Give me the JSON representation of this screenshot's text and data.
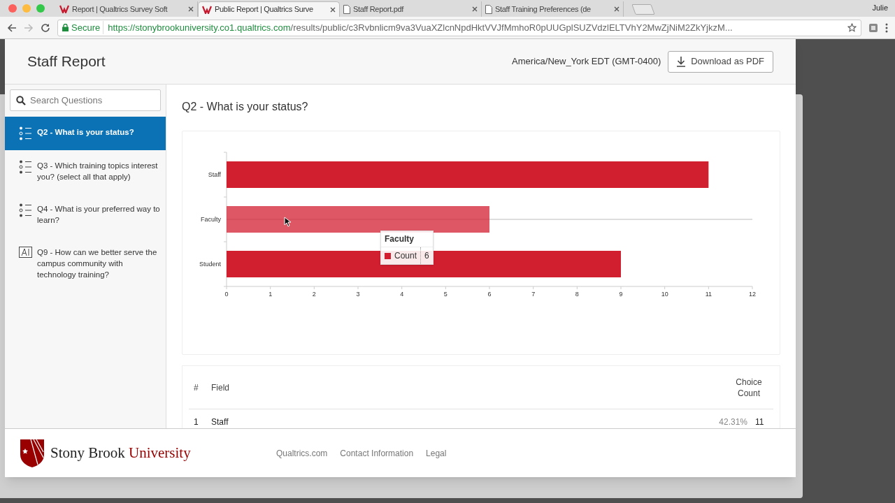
{
  "browser": {
    "tabs": [
      {
        "title": "Report | Qualtrics Survey Soft",
        "kind": "qualtrics",
        "selected": false
      },
      {
        "title": "Public Report | Qualtrics Surve",
        "kind": "qualtrics",
        "selected": true
      },
      {
        "title": "Staff Report.pdf",
        "kind": "document",
        "selected": false
      },
      {
        "title": "Staff Training Preferences (de",
        "kind": "document",
        "selected": false
      }
    ],
    "profile": "Julie",
    "secure_label": "Secure",
    "url_host": "https://stonybrookuniversity.co1.qualtrics.com",
    "url_path": "/results/public/c3Rvbnlicm9va3VuaXZlcnNpdHktVVJfMmhoR0pUUGplSUZVdzlELTVhY2MwZjNiM2ZkYjkzM..."
  },
  "header": {
    "title": "Staff Report",
    "timezone": "America/New_York EDT (GMT-0400)",
    "download_button": "Download as PDF"
  },
  "sidebar": {
    "search": {
      "placeholder": "Search Questions"
    },
    "items": [
      {
        "label": "Q2 - What is your status?",
        "kind": "multiple_choice",
        "selected": true
      },
      {
        "label": "Q3 - Which training topics interest you? (select all that apply)",
        "kind": "multiple_choice",
        "selected": false
      },
      {
        "label": "Q4 - What is your preferred way to learn?",
        "kind": "multiple_choice",
        "selected": false
      },
      {
        "label": "Q9 - How can we better serve the campus community with technology training?",
        "kind": "text_entry",
        "selected": false
      }
    ]
  },
  "question": {
    "title": "Q2 - What is your status?",
    "chart_data": {
      "type": "bar",
      "orientation": "horizontal",
      "categories": [
        "Staff",
        "Faculty",
        "Student"
      ],
      "series": [
        {
          "name": "Count",
          "color": "#d11f30",
          "values": [
            11,
            6,
            9
          ]
        }
      ],
      "xlim": [
        0,
        12
      ],
      "xticks": [
        0,
        1,
        2,
        3,
        4,
        5,
        6,
        7,
        8,
        9,
        10,
        11,
        12
      ]
    },
    "bar_states": [
      {
        "hovered": false
      },
      {
        "hovered": true
      },
      {
        "hovered": false
      }
    ],
    "tooltip": {
      "title": "Faculty",
      "value": "6"
    },
    "table": {
      "columns": [
        "#",
        "Field",
        "Choice Count"
      ],
      "rows": [
        [
          "1",
          "Staff",
          "42.31%",
          "11"
        ]
      ]
    }
  },
  "footer": {
    "logo_words": [
      "Stony Brook",
      "University"
    ],
    "links": [
      "Qualtrics.com",
      "Contact Information",
      "Legal"
    ]
  }
}
